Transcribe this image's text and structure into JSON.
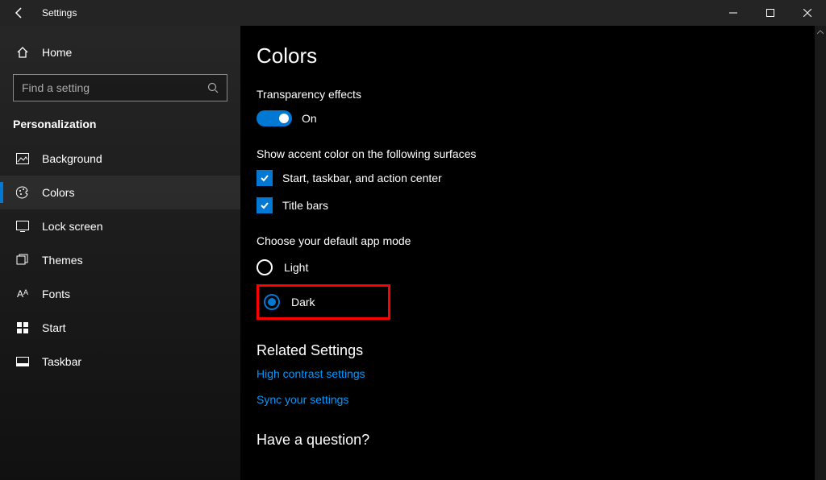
{
  "titlebar": {
    "title": "Settings"
  },
  "sidebar": {
    "home": "Home",
    "searchPlaceholder": "Find a setting",
    "category": "Personalization",
    "items": [
      {
        "label": "Background"
      },
      {
        "label": "Colors"
      },
      {
        "label": "Lock screen"
      },
      {
        "label": "Themes"
      },
      {
        "label": "Fonts"
      },
      {
        "label": "Start"
      },
      {
        "label": "Taskbar"
      }
    ]
  },
  "content": {
    "heading": "Colors",
    "transparency": {
      "label": "Transparency effects",
      "state": "On"
    },
    "accentSurfaces": {
      "label": "Show accent color on the following surfaces",
      "opt1": "Start, taskbar, and action center",
      "opt2": "Title bars"
    },
    "appMode": {
      "label": "Choose your default app mode",
      "light": "Light",
      "dark": "Dark"
    },
    "related": {
      "heading": "Related Settings",
      "link1": "High contrast settings",
      "link2": "Sync your settings"
    },
    "question": "Have a question?"
  }
}
